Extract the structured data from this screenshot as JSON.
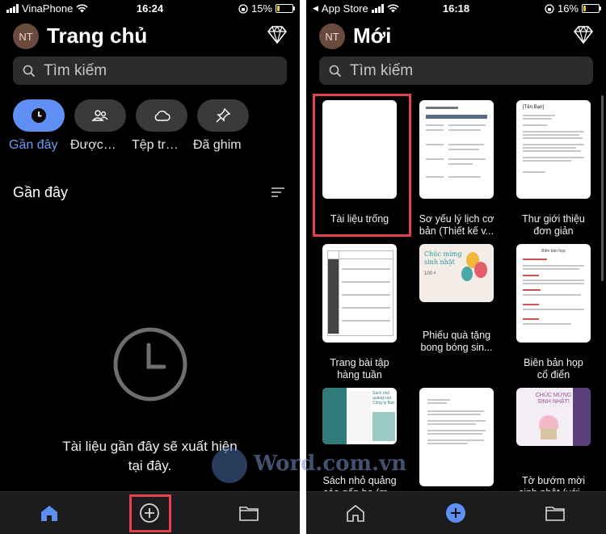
{
  "left": {
    "status": {
      "carrier": "VinaPhone",
      "time": "16:24",
      "battery": "15%"
    },
    "avatar_initials": "NT",
    "title": "Trang chủ",
    "search_placeholder": "Tìm kiếm",
    "filters": [
      {
        "label": "Gần đây",
        "icon": "clock-icon",
        "active": true
      },
      {
        "label": "Được…",
        "icon": "people-icon",
        "active": false
      },
      {
        "label": "Tệp tr…",
        "icon": "cloud-icon",
        "active": false
      },
      {
        "label": "Đã ghim",
        "icon": "pin-icon",
        "active": false
      }
    ],
    "section_title": "Gần đây",
    "empty_message_line1": "Tài liệu gần đây sẽ xuất hiện",
    "empty_message_line2": "tại đây.",
    "tabs": [
      "home-icon",
      "add-circle-icon",
      "folder-icon"
    ]
  },
  "right": {
    "status": {
      "carrier": "App Store",
      "time": "16:18",
      "battery": "16%"
    },
    "avatar_initials": "NT",
    "title": "Mới",
    "search_placeholder": "Tìm kiếm",
    "templates": [
      {
        "line1": "Tài liệu trống",
        "line2": ""
      },
      {
        "line1": "Sơ yếu lý lịch cơ",
        "line2": "bản (Thiết kế v..."
      },
      {
        "line1": "Thư giới thiệu",
        "line2": "đơn giản"
      },
      {
        "line1": "Trang bài tập",
        "line2": "hàng tuần"
      },
      {
        "line1": "Phiếu quà tặng",
        "line2": "bong bóng sin..."
      },
      {
        "line1": "Biên bản họp",
        "line2": "cổ điển"
      },
      {
        "line1": "Sách nhỏ quảng",
        "line2": "cáo gấp ba (m..."
      },
      {
        "line1": "",
        "line2": ""
      },
      {
        "line1": "Tờ bướm mời",
        "line2": "sinh nhật (với..."
      }
    ],
    "thumb_texts": {
      "cover_letter_name": "[Tên Bạn]",
      "meeting_title": "Biên bản họp",
      "voucher_line1": "Chúc mừng",
      "voucher_line2": "sinh nhật",
      "voucher_amount": "100 ₫",
      "booklet_text": "Sách nhỏ quảng cáo Công ty Bạn",
      "flyer_line1": "CHÚC MỪNG",
      "flyer_line2": "SINH NHẬT!"
    },
    "tabs": [
      "home-icon",
      "add-circle-icon",
      "folder-icon"
    ]
  },
  "watermark": "Word.com.vn",
  "colors": {
    "accent": "#5f8ff2",
    "highlight": "#e2404a",
    "battery": "#f2c641"
  }
}
